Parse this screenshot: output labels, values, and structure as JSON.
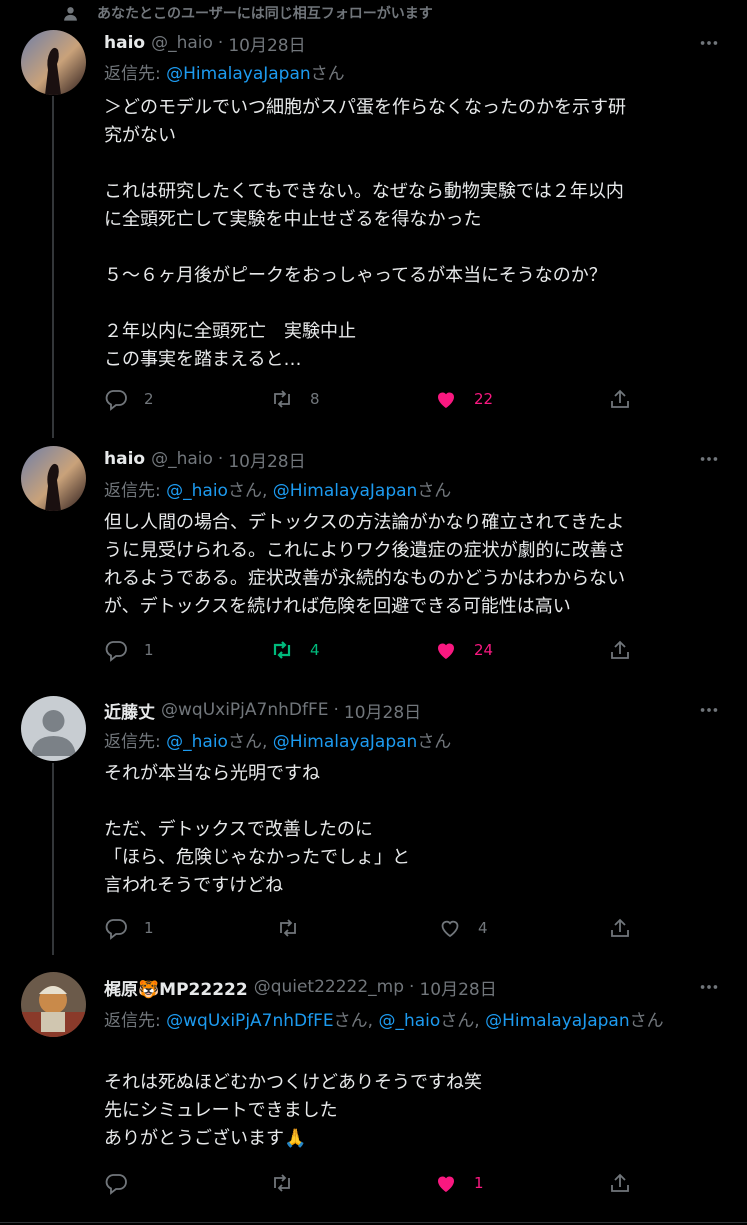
{
  "social_context": "あなたとこのユーザーには同じ相互フォローがいます",
  "reply_prefix": "返信先:",
  "san": "さん",
  "tweets": [
    {
      "name": "haio",
      "handle": "@_haio",
      "date": "10月28日",
      "mentions": [
        "@HimalayaJapan"
      ],
      "body": "＞どのモデルでいつ細胞がスパ蛋を作らなくなったのかを示す研\n究がない\n\nこれは研究したくてもできない。なぜなら動物実験では２年以内\nに全頭死亡して実験を中止せざるを得なかった\n\n５～６ヶ月後がピークをおっしゃってるが本当にそうなのか？\n\n２年以内に全頭死亡　実験中止\nこの事実を踏まえると…",
      "replies": "2",
      "retweets": "8",
      "likes": "22",
      "liked": true,
      "retweeted": false
    },
    {
      "name": "haio",
      "handle": "@_haio",
      "date": "10月28日",
      "mentions": [
        "@_haio",
        "@HimalayaJapan"
      ],
      "body": "但し人間の場合、デトックスの方法論がかなり確立されてきたよ\nうに見受けられる。これによりワク後遺症の症状が劇的に改善さ\nれるようである。症状改善が永続的なものかどうかはわからない\nが、デトックスを続ければ危険を回避できる可能性は高い",
      "replies": "1",
      "retweets": "4",
      "likes": "24",
      "liked": true,
      "retweeted": true
    },
    {
      "name": "近藤丈",
      "handle": "@wqUxiPjA7nhDfFE",
      "date": "10月28日",
      "mentions": [
        "@_haio",
        "@HimalayaJapan"
      ],
      "body": "それが本当なら光明ですね\n\nただ、デトックスで改善したのに\n「ほら、危険じゃなかったでしょ」と\n言われそうですけどね",
      "replies": "1",
      "retweets": "",
      "likes": "4",
      "liked": false,
      "retweeted": false
    },
    {
      "name": "梶原🐯MP22222",
      "handle": "@quiet22222_mp",
      "date": "10月28日",
      "mentions": [
        "@wqUxiPjA7nhDfFE",
        "@_haio",
        "@HimalayaJapan"
      ],
      "body": "それは死ぬほどむかつくけどありそうですね笑\n先にシミュレートできました\nありがとうございます🙏",
      "replies": "",
      "retweets": "",
      "likes": "1",
      "liked": true,
      "retweeted": false
    }
  ]
}
